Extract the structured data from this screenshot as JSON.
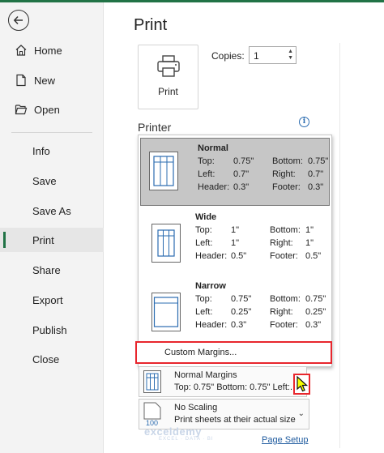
{
  "sidebar": {
    "items": [
      {
        "label": "Home"
      },
      {
        "label": "New"
      },
      {
        "label": "Open"
      },
      {
        "label": "Info"
      },
      {
        "label": "Save"
      },
      {
        "label": "Save As"
      },
      {
        "label": "Print"
      },
      {
        "label": "Share"
      },
      {
        "label": "Export"
      },
      {
        "label": "Publish"
      },
      {
        "label": "Close"
      }
    ],
    "active": "Print"
  },
  "main": {
    "title": "Print",
    "print_button_label": "Print",
    "copies_label": "Copies:",
    "copies_value": "1",
    "printer_section": "Printer"
  },
  "margins": {
    "options": [
      {
        "name": "Normal",
        "top_k": "Top:",
        "top": "0.75\"",
        "bottom_k": "Bottom:",
        "bottom": "0.75\"",
        "left_k": "Left:",
        "left": "0.7\"",
        "right_k": "Right:",
        "right": "0.7\"",
        "header_k": "Header:",
        "header": "0.3\"",
        "footer_k": "Footer:",
        "footer": "0.3\""
      },
      {
        "name": "Wide",
        "top_k": "Top:",
        "top": "1\"",
        "bottom_k": "Bottom:",
        "bottom": "1\"",
        "left_k": "Left:",
        "left": "1\"",
        "right_k": "Right:",
        "right": "1\"",
        "header_k": "Header:",
        "header": "0.5\"",
        "footer_k": "Footer:",
        "footer": "0.5\""
      },
      {
        "name": "Narrow",
        "top_k": "Top:",
        "top": "0.75\"",
        "bottom_k": "Bottom:",
        "bottom": "0.75\"",
        "left_k": "Left:",
        "left": "0.25\"",
        "right_k": "Right:",
        "right": "0.25\"",
        "header_k": "Header:",
        "header": "0.3\"",
        "footer_k": "Footer:",
        "footer": "0.3\""
      }
    ],
    "custom_label": "Custom Margins..."
  },
  "settings": {
    "margins_title": "Normal Margins",
    "margins_detail": "Top: 0.75\" Bottom: 0.75\" Left:...",
    "scaling_title": "No Scaling",
    "scaling_detail": "Print sheets at their actual size",
    "scaling_icon_text": "100"
  },
  "page_setup_link": "Page Setup",
  "watermark": {
    "brand": "exceldemy",
    "tagline": "EXCEL · DATA · BI"
  },
  "colors": {
    "accent": "#217346",
    "highlight": "#e8262d",
    "link": "#1e5a9e"
  }
}
